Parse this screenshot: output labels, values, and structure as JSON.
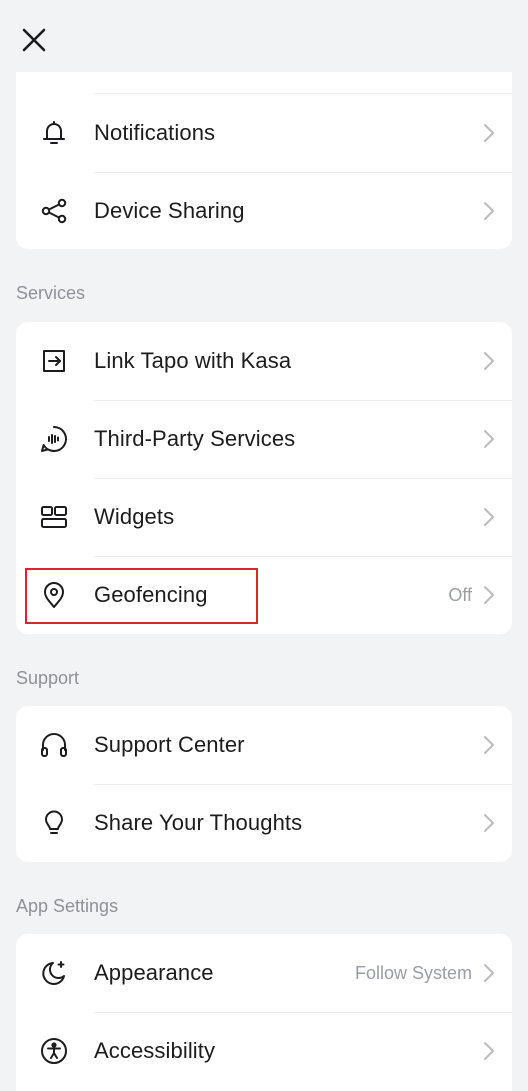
{
  "header": {
    "close_icon": "close-icon"
  },
  "account": {
    "items": [
      {
        "label": "Notifications",
        "icon": "bell-icon",
        "value": ""
      },
      {
        "label": "Device Sharing",
        "icon": "share-icon",
        "value": ""
      }
    ]
  },
  "services": {
    "title": "Services",
    "items": [
      {
        "label": "Link Tapo with Kasa",
        "icon": "link-arrow-icon",
        "value": ""
      },
      {
        "label": "Third-Party Services",
        "icon": "voice-chat-icon",
        "value": ""
      },
      {
        "label": "Widgets",
        "icon": "widgets-icon",
        "value": ""
      },
      {
        "label": "Geofencing",
        "icon": "location-pin-icon",
        "value": "Off"
      }
    ]
  },
  "support": {
    "title": "Support",
    "items": [
      {
        "label": "Support Center",
        "icon": "headset-icon",
        "value": ""
      },
      {
        "label": "Share Your Thoughts",
        "icon": "lightbulb-icon",
        "value": ""
      }
    ]
  },
  "app_settings": {
    "title": "App Settings",
    "items": [
      {
        "label": "Appearance",
        "icon": "moon-icon",
        "value": "Follow System"
      },
      {
        "label": "Accessibility",
        "icon": "accessibility-icon",
        "value": ""
      }
    ]
  },
  "colors": {
    "background": "#f2f3f5",
    "card": "#ffffff",
    "text": "#1c1c1e",
    "secondary_text": "#8e9197",
    "chevron": "#b8bbc0",
    "highlight_border": "#d9262c"
  }
}
